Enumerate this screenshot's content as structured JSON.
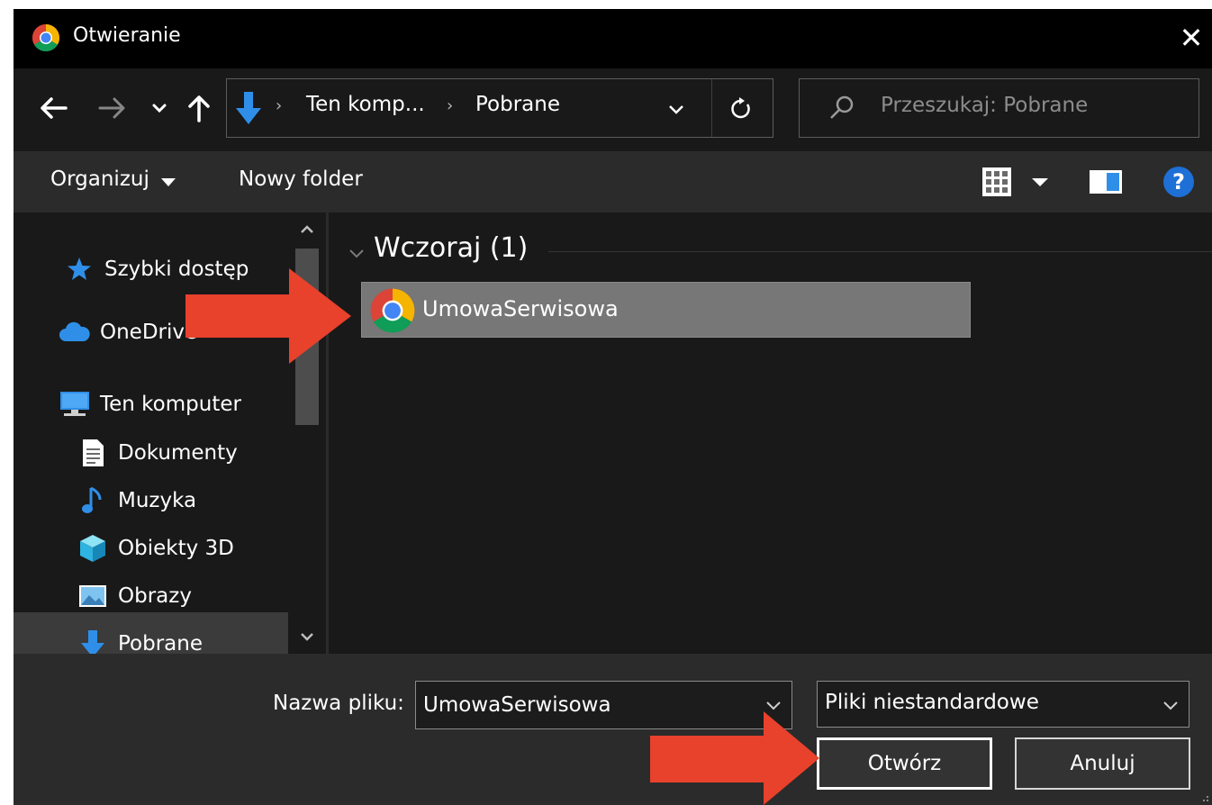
{
  "window": {
    "title": "Otwieranie",
    "close_glyph": "✕"
  },
  "address_bar": {
    "crumbs": [
      "Ten komp...",
      "Pobrane"
    ],
    "separator": "›"
  },
  "search": {
    "placeholder": "Przeszukaj: Pobrane"
  },
  "toolbar": {
    "organize_label": "Organizuj",
    "new_folder_label": "Nowy folder",
    "help_glyph": "?"
  },
  "sidebar": {
    "items": [
      {
        "label": "Szybki dostęp",
        "icon": "star-icon"
      },
      {
        "label": "OneDrive",
        "icon": "cloud-icon"
      },
      {
        "label": "Ten komputer",
        "icon": "computer-icon"
      },
      {
        "label": "Dokumenty",
        "icon": "document-icon"
      },
      {
        "label": "Muzyka",
        "icon": "music-note-icon"
      },
      {
        "label": "Obiekty 3D",
        "icon": "cube-icon"
      },
      {
        "label": "Obrazy",
        "icon": "picture-icon"
      },
      {
        "label": "Pobrane",
        "icon": "download-arrow-icon"
      }
    ],
    "selected": "Pobrane"
  },
  "file_list": {
    "group_title": "Wczoraj (1)",
    "files": [
      {
        "name": "UmowaSerwisowa",
        "icon": "chrome-icon",
        "selected": true
      }
    ]
  },
  "bottom": {
    "filename_label": "Nazwa pliku:",
    "filename_value": "UmowaSerwisowa",
    "filetype_value": "Pliki niestandardowe",
    "open_label": "Otwórz",
    "cancel_label": "Anuluj"
  },
  "colors": {
    "background": "#191919",
    "titlebar": "#000000",
    "toolbar": "#2b2b2b",
    "selection": "#777777",
    "annotation_arrow": "#e8412c",
    "accent_blue": "#1e6fd6"
  }
}
